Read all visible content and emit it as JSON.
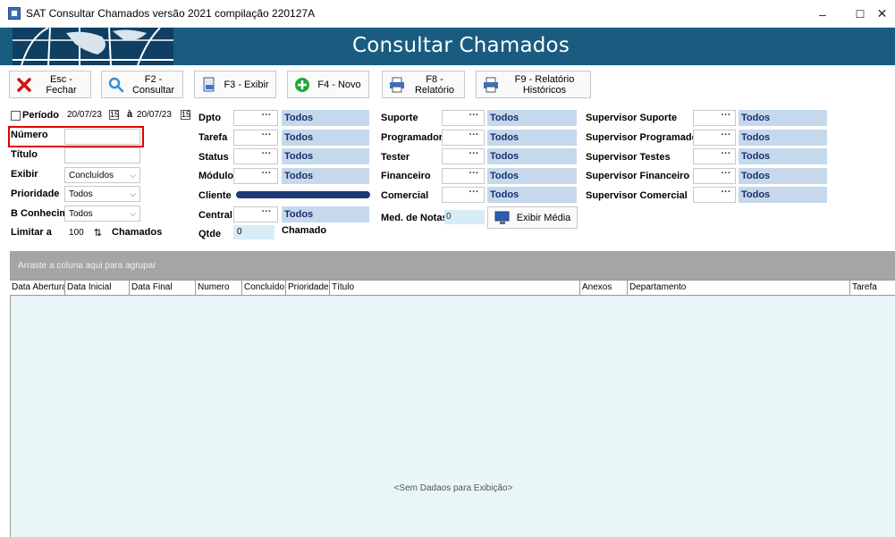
{
  "window": {
    "title": "SAT Consultar Chamados versão 2021 compilação 220127A",
    "minimize": "–",
    "maximize": "☐",
    "close": "✕"
  },
  "banner": {
    "heading": "Consultar Chamados"
  },
  "toolbar": {
    "buttons": [
      {
        "label": "Esc - Fechar",
        "icon": "close-x-icon"
      },
      {
        "label": "F2 - Consultar",
        "icon": "search-icon"
      },
      {
        "label": "F3 - Exibir",
        "icon": "document-icon"
      },
      {
        "label": "F4 - Novo",
        "icon": "plus-icon"
      },
      {
        "label": "F8 - Relatório",
        "icon": "printer-icon"
      },
      {
        "label": "F9 - Relatório Históricos",
        "icon": "printer-icon"
      }
    ]
  },
  "form": {
    "periodo": {
      "label": "Período",
      "from": "20/07/23",
      "sep": "à",
      "to": "20/07/23",
      "cal": "15"
    },
    "numero": {
      "label": "Número",
      "value": ""
    },
    "titulo": {
      "label": "Título",
      "value": ""
    },
    "exibir": {
      "label": "Exibir",
      "value": "Concluídos"
    },
    "prioridade": {
      "label": "Prioridade",
      "value": "Todos"
    },
    "bconhecim": {
      "label": "B Conhecim.",
      "value": "Todos"
    },
    "limitar": {
      "label": "Limitar a",
      "value": "100",
      "suffix": "Chamados",
      "spin": "⇅"
    },
    "col2": [
      {
        "label": "Dpto",
        "value": "Todos"
      },
      {
        "label": "Tarefa",
        "value": "Todos"
      },
      {
        "label": "Status",
        "value": "Todos"
      },
      {
        "label": "Módulo",
        "value": "Todos"
      },
      {
        "label": "Cliente",
        "value": ""
      },
      {
        "label": "Central",
        "value": "Todos"
      }
    ],
    "qtde": {
      "label": "Qtde",
      "value": "0",
      "suffix": "Chamado"
    },
    "col3": [
      {
        "label": "Suporte",
        "value": "Todos"
      },
      {
        "label": "Programador",
        "value": "Todos"
      },
      {
        "label": "Tester",
        "value": "Todos"
      },
      {
        "label": "Financeiro",
        "value": "Todos"
      },
      {
        "label": "Comercial",
        "value": "Todos"
      }
    ],
    "med_notas": {
      "label": "Med. de Notas",
      "value": "0"
    },
    "exibir_media": {
      "label": "Exibir Média"
    },
    "col4": [
      {
        "label": "Supervisor Suporte",
        "value": "Todos"
      },
      {
        "label": "Supervisor Programador",
        "value": "Todos"
      },
      {
        "label": "Supervisor Testes",
        "value": "Todos"
      },
      {
        "label": "Supervisor Financeiro",
        "value": "Todos"
      },
      {
        "label": "Supervisor Comercial",
        "value": "Todos"
      }
    ],
    "dots": "···"
  },
  "grid": {
    "group_hint": "Arraste a coluna aqui para agrupar",
    "columns": [
      "Data Abertura",
      "Data Inicial",
      "Data Final",
      "Numero",
      "Concluído",
      "Prioridade",
      "Título",
      "Anexos",
      "Departamento",
      "Tarefa"
    ],
    "empty_text": "<Sem Dadaos para Exibição>"
  },
  "colors": {
    "banner": "#1a5c80",
    "lookup_value": "#c6d8ec",
    "highlight": "#e00000",
    "grid_body": "#e8f6f8"
  }
}
